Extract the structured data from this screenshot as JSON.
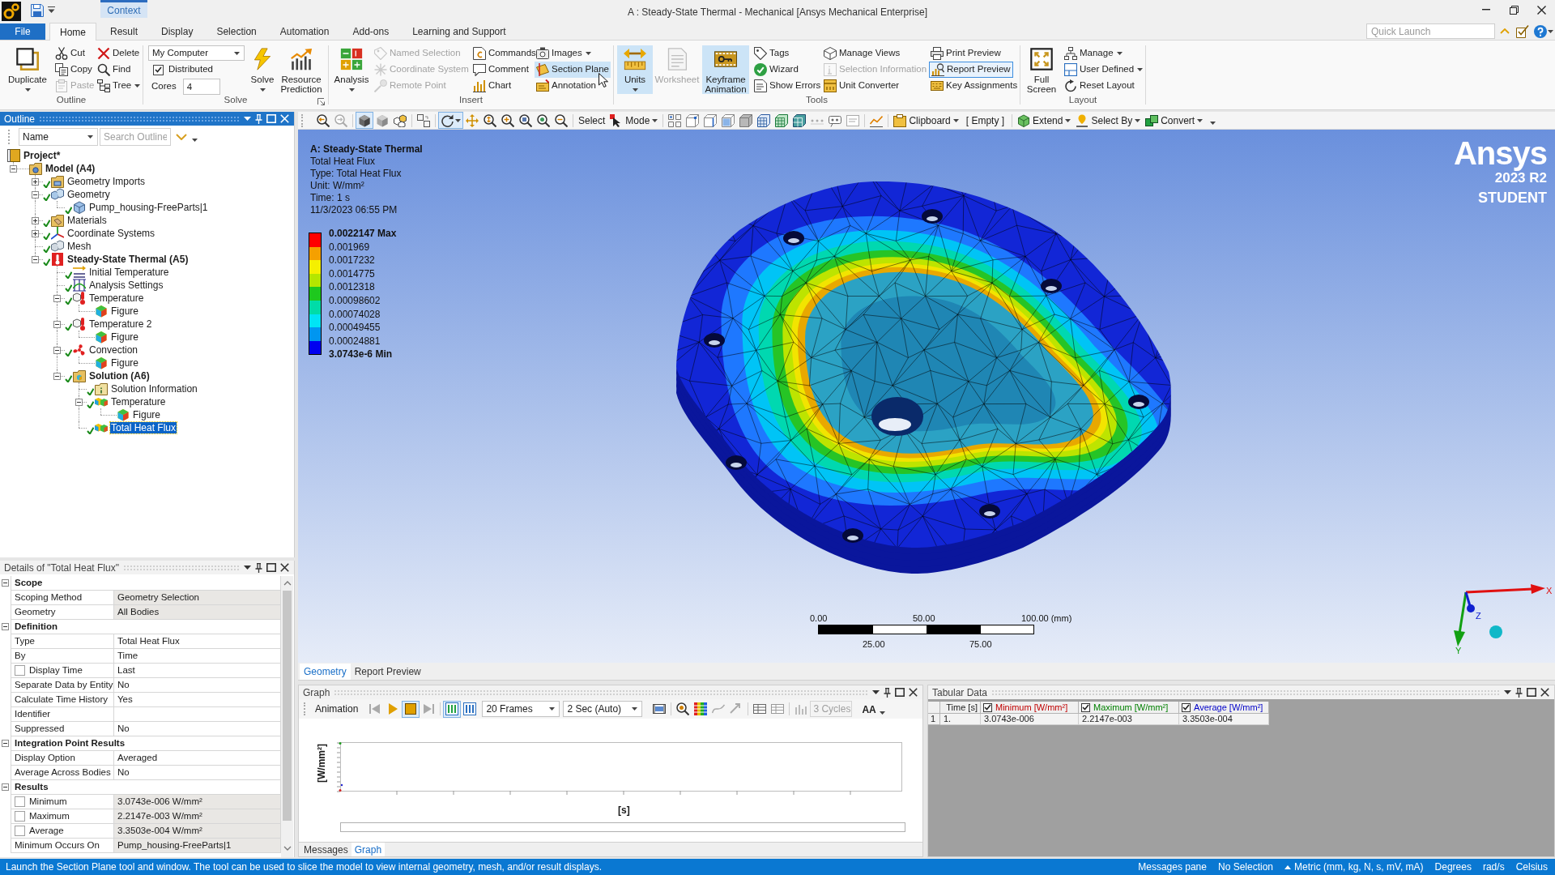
{
  "title_bar": {
    "context_tab": "Context",
    "title": "A : Steady-State Thermal - Mechanical [Ansys Mechanical Enterprise]"
  },
  "tabs": [
    {
      "label": "File",
      "kind": "file",
      "selected": false
    },
    {
      "label": "Home",
      "kind": "tab",
      "selected": true
    },
    {
      "label": "Result",
      "kind": "tab",
      "selected": false
    },
    {
      "label": "Display",
      "kind": "tab",
      "selected": false
    },
    {
      "label": "Selection",
      "kind": "tab",
      "selected": false
    },
    {
      "label": "Automation",
      "kind": "tab",
      "selected": false
    },
    {
      "label": "Add-ons",
      "kind": "tab",
      "selected": false
    },
    {
      "label": "Learning and Support",
      "kind": "tab",
      "selected": false
    }
  ],
  "quick_launch": {
    "placeholder": "Quick Launch"
  },
  "ribbon": {
    "groups": [
      {
        "label": "Outline",
        "items": [
          {
            "kind": "large",
            "label": "Duplicate",
            "menu": true,
            "disabled": false,
            "highlighted": false,
            "focused": false
          },
          {
            "kind": "stack",
            "buttons": [
              {
                "label": "Cut",
                "menu": false,
                "disabled": false,
                "highlighted": false,
                "focused": false
              },
              {
                "label": "Copy",
                "menu": false,
                "disabled": false,
                "highlighted": false,
                "focused": false
              },
              {
                "label": "Paste",
                "menu": false,
                "disabled": true,
                "highlighted": false,
                "focused": false
              }
            ]
          },
          {
            "kind": "stack",
            "buttons": [
              {
                "label": "Delete",
                "menu": false,
                "disabled": false,
                "highlighted": false,
                "focused": false
              },
              {
                "label": "Find",
                "menu": false,
                "disabled": false,
                "highlighted": false,
                "focused": false
              },
              {
                "label": "Tree",
                "menu": true,
                "disabled": false,
                "highlighted": false,
                "focused": false
              }
            ]
          }
        ]
      },
      {
        "label": "Solve",
        "items": [
          {
            "kind": "controls",
            "controls": [
              {
                "kind": "select",
                "value": "My Computer"
              },
              {
                "kind": "checkbox",
                "label": "Distributed",
                "checked": true
              },
              {
                "kind": "spin",
                "label": "Cores",
                "value": "4"
              }
            ]
          },
          {
            "kind": "large",
            "label": "Solve",
            "menu": true,
            "disabled": false,
            "highlighted": false,
            "focused": false
          },
          {
            "kind": "large",
            "label": "Resource Prediction",
            "menu": false,
            "disabled": false,
            "highlighted": false,
            "focused": false
          }
        ]
      },
      {
        "label": "Insert",
        "items": [
          {
            "kind": "large",
            "label": "Analysis",
            "menu": true,
            "disabled": false,
            "highlighted": false,
            "focused": false
          },
          {
            "kind": "stack",
            "buttons": [
              {
                "label": "Named Selection",
                "menu": false,
                "disabled": true,
                "highlighted": false,
                "focused": false
              },
              {
                "label": "Coordinate System",
                "menu": false,
                "disabled": true,
                "highlighted": false,
                "focused": false
              },
              {
                "label": "Remote Point",
                "menu": false,
                "disabled": true,
                "highlighted": false,
                "focused": false
              }
            ]
          },
          {
            "kind": "stack",
            "buttons": [
              {
                "label": "Commands",
                "menu": false,
                "disabled": false,
                "highlighted": false,
                "focused": false
              },
              {
                "label": "Comment",
                "menu": false,
                "disabled": false,
                "highlighted": false,
                "focused": false
              },
              {
                "label": "Chart",
                "menu": false,
                "disabled": false,
                "highlighted": false,
                "focused": false
              }
            ]
          },
          {
            "kind": "stack",
            "buttons": [
              {
                "label": "Images",
                "menu": true,
                "disabled": false,
                "highlighted": false,
                "focused": false
              },
              {
                "label": "Section Plane",
                "menu": false,
                "disabled": false,
                "highlighted": true,
                "focused": false
              },
              {
                "label": "Annotation",
                "menu": false,
                "disabled": false,
                "highlighted": false,
                "focused": false
              }
            ]
          }
        ]
      },
      {
        "label": "Tools",
        "items": [
          {
            "kind": "large",
            "label": "Units",
            "menu": true,
            "disabled": false,
            "highlighted": true,
            "focused": false
          },
          {
            "kind": "large",
            "label": "Worksheet",
            "menu": false,
            "disabled": true,
            "highlighted": false,
            "focused": false
          },
          {
            "kind": "large",
            "label": "Keyframe Animation",
            "menu": false,
            "disabled": false,
            "highlighted": true,
            "focused": false
          },
          {
            "kind": "stack",
            "buttons": [
              {
                "label": "Tags",
                "menu": false,
                "disabled": false,
                "highlighted": false,
                "focused": false
              },
              {
                "label": "Wizard",
                "menu": false,
                "disabled": false,
                "highlighted": false,
                "focused": false
              },
              {
                "label": "Show Errors",
                "menu": false,
                "disabled": false,
                "highlighted": false,
                "focused": false
              }
            ]
          },
          {
            "kind": "stack",
            "buttons": [
              {
                "label": "Manage Views",
                "menu": false,
                "disabled": false,
                "highlighted": false,
                "focused": false
              },
              {
                "label": "Selection Information",
                "menu": false,
                "disabled": true,
                "highlighted": false,
                "focused": false
              },
              {
                "label": "Unit Converter",
                "menu": false,
                "disabled": false,
                "highlighted": false,
                "focused": false
              }
            ]
          },
          {
            "kind": "stack",
            "buttons": [
              {
                "label": "Print Preview",
                "menu": false,
                "disabled": false,
                "highlighted": false,
                "focused": false
              },
              {
                "label": "Report Preview",
                "menu": false,
                "disabled": false,
                "highlighted": false,
                "focused": true
              },
              {
                "label": "Key Assignments",
                "menu": false,
                "disabled": false,
                "highlighted": false,
                "focused": false
              }
            ]
          }
        ]
      },
      {
        "label": "Layout",
        "items": [
          {
            "kind": "large",
            "label": "Full Screen",
            "menu": false,
            "disabled": false,
            "highlighted": false,
            "focused": false
          },
          {
            "kind": "stack",
            "buttons": [
              {
                "label": "Manage",
                "menu": true,
                "disabled": false,
                "highlighted": false,
                "focused": false
              },
              {
                "label": "User Defined",
                "menu": true,
                "disabled": false,
                "highlighted": false,
                "focused": false
              },
              {
                "label": "Reset Layout",
                "menu": false,
                "disabled": false,
                "highlighted": false,
                "focused": false
              }
            ]
          }
        ]
      }
    ]
  },
  "viewport_toolbar": {
    "select": "Select",
    "mode": "Mode",
    "clipboard": "Clipboard",
    "clipboard_contents": "[ Empty ]",
    "extend": "Extend",
    "select_by": "Select By",
    "convert": "Convert"
  },
  "outline": {
    "title": "Outline",
    "filter": "Name",
    "search": {
      "placeholder": "Search Outline"
    },
    "tree": {
      "label": "Project*",
      "kind": "project",
      "bold": true,
      "ok": false,
      "selected": false,
      "children": [
        {
          "label": "Model (A4)",
          "kind": "model",
          "bold": true,
          "ok": false,
          "selected": false,
          "expanded": true,
          "children": [
            {
              "label": "Geometry Imports",
              "kind": "imports",
              "bold": false,
              "ok": true,
              "selected": false,
              "expanded": false
            },
            {
              "label": "Geometry",
              "kind": "geometry",
              "bold": false,
              "ok": true,
              "selected": false,
              "expanded": true,
              "children": [
                {
                  "label": "Pump_housing-FreeParts|1",
                  "kind": "body",
                  "bold": false,
                  "ok": true,
                  "selected": false
                }
              ]
            },
            {
              "label": "Materials",
              "kind": "materials",
              "bold": false,
              "ok": true,
              "selected": false,
              "expanded": false
            },
            {
              "label": "Coordinate Systems",
              "kind": "coordinates",
              "bold": false,
              "ok": true,
              "selected": false,
              "expanded": false
            },
            {
              "label": "Mesh",
              "kind": "mesh",
              "bold": false,
              "ok": true,
              "selected": false
            },
            {
              "label": "Steady-State Thermal (A5)",
              "kind": "analysis",
              "bold": true,
              "ok": true,
              "selected": false,
              "expanded": true,
              "children": [
                {
                  "label": "Initial Temperature",
                  "kind": "initial",
                  "bold": false,
                  "ok": true,
                  "selected": false
                },
                {
                  "label": "Analysis Settings",
                  "kind": "settings",
                  "bold": false,
                  "ok": true,
                  "selected": false
                },
                {
                  "label": "Temperature",
                  "kind": "load",
                  "bold": false,
                  "ok": true,
                  "selected": false,
                  "expanded": true,
                  "children": [
                    {
                      "label": "Figure",
                      "kind": "figure",
                      "bold": false,
                      "ok": false,
                      "selected": false
                    }
                  ]
                },
                {
                  "label": "Temperature 2",
                  "kind": "load",
                  "bold": false,
                  "ok": true,
                  "selected": false,
                  "expanded": true,
                  "children": [
                    {
                      "label": "Figure",
                      "kind": "figure",
                      "bold": false,
                      "ok": false,
                      "selected": false
                    }
                  ]
                },
                {
                  "label": "Convection",
                  "kind": "convection",
                  "bold": false,
                  "ok": true,
                  "selected": false,
                  "expanded": true,
                  "children": [
                    {
                      "label": "Figure",
                      "kind": "figure",
                      "bold": false,
                      "ok": false,
                      "selected": false
                    }
                  ]
                },
                {
                  "label": "Solution (A6)",
                  "kind": "solution",
                  "bold": true,
                  "ok": true,
                  "selected": false,
                  "expanded": true,
                  "children": [
                    {
                      "label": "Solution Information",
                      "kind": "info",
                      "bold": false,
                      "ok": true,
                      "selected": false
                    },
                    {
                      "label": "Temperature",
                      "kind": "result",
                      "bold": false,
                      "ok": true,
                      "selected": false,
                      "expanded": true,
                      "children": [
                        {
                          "label": "Figure",
                          "kind": "figure",
                          "bold": false,
                          "ok": false,
                          "selected": false
                        }
                      ]
                    },
                    {
                      "label": "Total Heat Flux",
                      "kind": "result",
                      "bold": false,
                      "ok": true,
                      "selected": true
                    }
                  ]
                }
              ]
            }
          ]
        }
      ]
    }
  },
  "details": {
    "title": "Details of \"Total Heat Flux\"",
    "sections": [
      {
        "title": "Scope",
        "expanded": true,
        "rows": [
          {
            "label": "Scoping Method",
            "value": "Geometry Selection",
            "kind": "text",
            "readonly": true
          },
          {
            "label": "Geometry",
            "value": "All Bodies",
            "kind": "text",
            "readonly": true
          }
        ]
      },
      {
        "title": "Definition",
        "expanded": true,
        "rows": [
          {
            "label": "Type",
            "value": "Total Heat Flux",
            "kind": "text",
            "readonly": false
          },
          {
            "label": "By",
            "value": "Time",
            "kind": "text",
            "readonly": false
          },
          {
            "label": "Display Time",
            "value": "Last",
            "kind": "checkbox",
            "checked": false,
            "readonly": false
          },
          {
            "label": "Separate Data by Entity",
            "value": "No",
            "kind": "text",
            "readonly": false
          },
          {
            "label": "Calculate Time History",
            "value": "Yes",
            "kind": "text",
            "readonly": false
          },
          {
            "label": "Identifier",
            "kind": "text",
            "readonly": false
          },
          {
            "label": "Suppressed",
            "value": "No",
            "kind": "text",
            "readonly": false
          }
        ]
      },
      {
        "title": "Integration Point Results",
        "expanded": true,
        "rows": [
          {
            "label": "Display Option",
            "value": "Averaged",
            "kind": "text",
            "readonly": false
          },
          {
            "label": "Average Across Bodies",
            "value": "No",
            "kind": "text",
            "readonly": false
          }
        ]
      },
      {
        "title": "Results",
        "expanded": true,
        "rows": [
          {
            "label": "Minimum",
            "value": "3.0743e-006 W/mm²",
            "kind": "checkbox",
            "checked": false,
            "readonly": true
          },
          {
            "label": "Maximum",
            "value": "2.2147e-003 W/mm²",
            "kind": "checkbox",
            "checked": false,
            "readonly": true
          },
          {
            "label": "Average",
            "value": "3.3503e-004 W/mm²",
            "kind": "checkbox",
            "checked": false,
            "readonly": true
          },
          {
            "label": "Minimum Occurs On",
            "value": "Pump_housing-FreeParts|1",
            "kind": "text",
            "readonly": true
          }
        ]
      }
    ]
  },
  "viewport": {
    "info": {
      "title": "A: Steady-State Thermal",
      "lines": [
        "Total Heat Flux",
        "Type: Total Heat Flux",
        "Unit: W/mm²",
        "Time: 1 s",
        "11/3/2023 06:55 PM"
      ]
    },
    "legend": {
      "max": "0.0022147 Max",
      "values": [
        "0.001969",
        "0.0017232",
        "0.0014775",
        "0.0012318",
        "0.00098602",
        "0.00074028",
        "0.00049455",
        "0.00024881"
      ],
      "min": "3.0743e-6 Min",
      "bands": [
        {
          "color": "#ff0000"
        },
        {
          "color": "#f5a000"
        },
        {
          "color": "#f5f000"
        },
        {
          "color": "#b4e600"
        },
        {
          "color": "#1ec81e"
        },
        {
          "color": "#00dca8"
        },
        {
          "color": "#00e4f5"
        },
        {
          "color": "#0096f0"
        },
        {
          "color": "#0000f0"
        }
      ]
    },
    "branding": {
      "logo": "Ansys",
      "version": "2023 R2",
      "edition": "STUDENT"
    },
    "scale": {
      "top_labels": [
        "0.00",
        "50.00",
        "100.00 (mm)"
      ],
      "bottom_labels": [
        "25.00",
        "75.00"
      ]
    },
    "triad": {
      "x": "X",
      "y": "Y",
      "z": "Z"
    },
    "tabs": [
      {
        "label": "Geometry",
        "selected": true
      },
      {
        "label": "Report Preview",
        "selected": false
      }
    ]
  },
  "graph": {
    "title": "Graph",
    "toolbar": {
      "label": "Animation",
      "frames": "20 Frames",
      "duration": "2 Sec (Auto)",
      "cycles": {
        "value": "3 Cycles",
        "disabled": true
      },
      "text_size": "AA"
    },
    "ylabel": "[W/mm²]",
    "xlabel": "[s]",
    "tabs": [
      {
        "label": "Messages",
        "selected": false
      },
      {
        "label": "Graph",
        "selected": true
      }
    ]
  },
  "tabular_data": {
    "title": "Tabular Data",
    "columns": [
      {
        "label": "Time [s]",
        "kind": "axis"
      },
      {
        "label": "Minimum [W/mm²]",
        "kind": "series",
        "checked": true,
        "color": "#c00000"
      },
      {
        "label": "Maximum [W/mm²]",
        "kind": "series",
        "checked": true,
        "color": "#008000"
      },
      {
        "label": "Average [W/mm²]",
        "kind": "series",
        "checked": true,
        "color": "#0000c8"
      }
    ],
    "rows": [
      {
        "number": "1",
        "cells": [
          "1.",
          "3.0743e-006",
          "2.2147e-003",
          "3.3503e-004"
        ]
      }
    ]
  },
  "status_bar": {
    "message": "Launch the Section Plane tool and window. The tool can be used to slice the model to view internal geometry, mesh, and/or result displays.",
    "items": [
      {
        "text": "Messages pane",
        "kind": "plain"
      },
      {
        "text": "No Selection",
        "kind": "plain"
      },
      {
        "text": "Metric (mm, kg, N, s, mV, mA)",
        "kind": "menu"
      },
      {
        "text": "Degrees",
        "kind": "plain"
      },
      {
        "text": "rad/s",
        "kind": "plain"
      },
      {
        "text": "Celsius",
        "kind": "plain"
      }
    ]
  }
}
